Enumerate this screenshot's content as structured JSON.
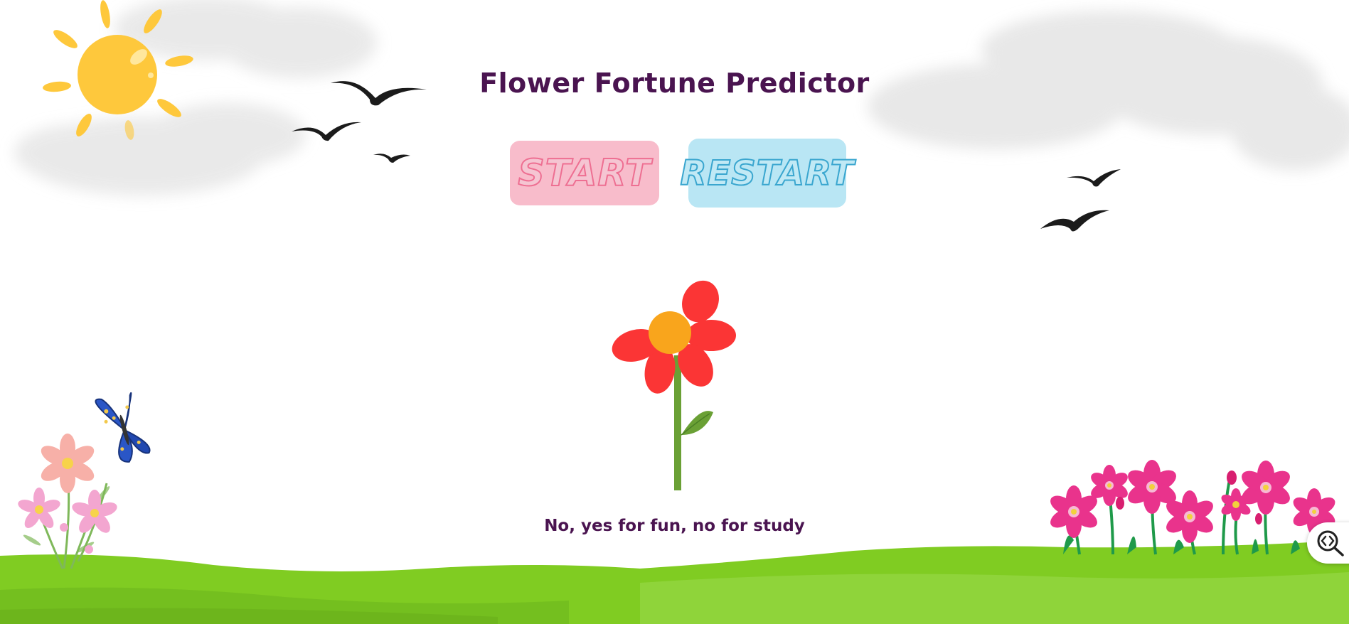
{
  "title": "Flower Fortune Predictor",
  "buttons": {
    "start_label": "START",
    "restart_label": "RESTART"
  },
  "answer_text": "No, yes for fun, no for study",
  "colors": {
    "title": "#4a1450",
    "start_bg": "#f8bccb",
    "start_outline": "#ee6f92",
    "restart_bg": "#b9e6f4",
    "restart_outline": "#3aa6cf",
    "petal": "#fb3535",
    "flower_center": "#f9a51c",
    "stem": "#6aa035",
    "grass": "#80cc22",
    "sun": "#fec83c"
  },
  "icons": {
    "zoom_fab": "code-search-icon"
  }
}
